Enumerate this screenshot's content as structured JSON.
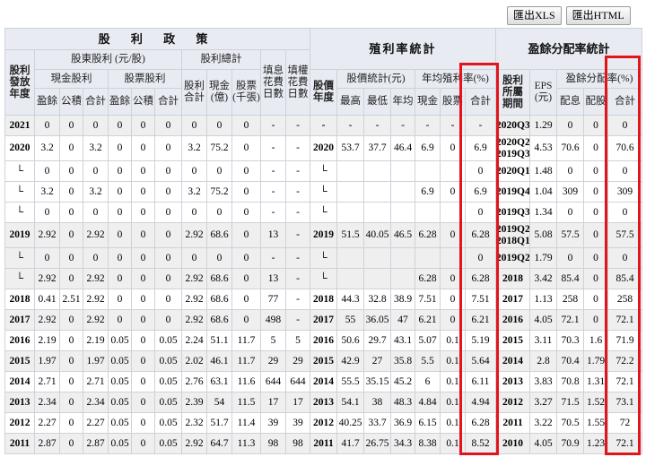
{
  "toolbar": {
    "export_xls": "匯出XLS",
    "export_html": "匯出HTML"
  },
  "colors": {
    "header_bg": "#e8ebf2",
    "row_shade": "#efefef",
    "highlight": "#e3151c"
  },
  "header": {
    "dividend_policy": "股 利 政 策",
    "yield_stats": "殖利率統計",
    "payout_stats": "盈餘分配率統計",
    "dividend_year": "股利\n發放\n年度",
    "shareholder_dividend": "股東股利 (元/股)",
    "dividend_total": "股利總計",
    "fill_dividend_days": "填息\n花費\n日數",
    "fill_rights_days": "填權\n花費\n日數",
    "cash_dividend": "現金股利",
    "stock_dividend": "股票股利",
    "dividend_sum": "股利\n合計",
    "cash_amount": "現金\n(億)",
    "stock_amount": "股票\n(千張)",
    "earnings": "盈餘",
    "reserve": "公積",
    "total": "合計",
    "price_year": "股價\n年度",
    "price_stats": "股價統計(元)",
    "avg_yield": "年均殖利率(%)",
    "high": "最高",
    "low": "最低",
    "avg": "年均",
    "cash": "現金",
    "stock": "股票",
    "period": "股利\n所屬\n期間",
    "eps": "EPS\n(元)",
    "payout_ratio": "盈餘分配率(%)",
    "cash_payout": "配息",
    "stock_payout": "配股"
  },
  "rows": [
    {
      "div": [
        "2021",
        "0",
        "0",
        "0",
        "0",
        "0",
        "0",
        "0",
        "0",
        "0",
        "-",
        "-"
      ],
      "yld": [
        "-",
        "-",
        "-",
        "-",
        "-",
        "-",
        "-"
      ],
      "pay": [
        "2020Q3",
        "1.29",
        "0",
        "0",
        "0"
      ]
    },
    {
      "div": [
        "2020",
        "3.2",
        "0",
        "3.2",
        "0",
        "0",
        "0",
        "3.2",
        "75.2",
        "0",
        "-",
        "-"
      ],
      "yld": [
        "2020",
        "53.7",
        "37.7",
        "46.4",
        "6.9",
        "0",
        "6.9"
      ],
      "pay": [
        "2020Q2\n2019Q3",
        "4.53",
        "70.6",
        "0",
        "70.6"
      ]
    },
    {
      "div": [
        "└",
        "0",
        "0",
        "0",
        "0",
        "0",
        "0",
        "0",
        "0",
        "0",
        "-",
        "-"
      ],
      "yld": [
        "└",
        "",
        "",
        "",
        "",
        "",
        "0"
      ],
      "pay": [
        "2020Q1",
        "1.48",
        "0",
        "0",
        "0"
      ]
    },
    {
      "div": [
        "└",
        "3.2",
        "0",
        "3.2",
        "0",
        "0",
        "0",
        "3.2",
        "75.2",
        "0",
        "-",
        "-"
      ],
      "yld": [
        "└",
        "",
        "",
        "",
        "6.9",
        "0",
        "6.9"
      ],
      "pay": [
        "2019Q4",
        "1.04",
        "309",
        "0",
        "309"
      ]
    },
    {
      "div": [
        "└",
        "0",
        "0",
        "0",
        "0",
        "0",
        "0",
        "0",
        "0",
        "0",
        "-",
        "-"
      ],
      "yld": [
        "└",
        "",
        "",
        "",
        "",
        "",
        "0"
      ],
      "pay": [
        "2019Q3",
        "1.34",
        "0",
        "0",
        "0"
      ]
    },
    {
      "div": [
        "2019",
        "2.92",
        "0",
        "2.92",
        "0",
        "0",
        "0",
        "2.92",
        "68.6",
        "0",
        "13",
        "-"
      ],
      "yld": [
        "2019",
        "51.5",
        "40.05",
        "46.5",
        "6.28",
        "0",
        "6.28"
      ],
      "pay": [
        "2019Q2\n2018Q1",
        "5.08",
        "57.5",
        "0",
        "57.5"
      ]
    },
    {
      "div": [
        "└",
        "0",
        "0",
        "0",
        "0",
        "0",
        "0",
        "0",
        "0",
        "0",
        "-",
        "-"
      ],
      "yld": [
        "└",
        "",
        "",
        "",
        "",
        "",
        "0"
      ],
      "pay": [
        "2019Q2",
        "1.79",
        "0",
        "0",
        "0"
      ]
    },
    {
      "div": [
        "└",
        "2.92",
        "0",
        "2.92",
        "0",
        "0",
        "0",
        "2.92",
        "68.6",
        "0",
        "13",
        "-"
      ],
      "yld": [
        "└",
        "",
        "",
        "",
        "6.28",
        "0",
        "6.28"
      ],
      "pay": [
        "2018",
        "3.42",
        "85.4",
        "0",
        "85.4"
      ]
    },
    {
      "div": [
        "2018",
        "0.41",
        "2.51",
        "2.92",
        "0",
        "0",
        "0",
        "2.92",
        "68.6",
        "0",
        "77",
        "-"
      ],
      "yld": [
        "2018",
        "44.3",
        "32.8",
        "38.9",
        "7.51",
        "0",
        "7.51"
      ],
      "pay": [
        "2017",
        "1.13",
        "258",
        "0",
        "258"
      ]
    },
    {
      "div": [
        "2017",
        "2.92",
        "0",
        "2.92",
        "0",
        "0",
        "0",
        "2.92",
        "68.6",
        "0",
        "498",
        "-"
      ],
      "yld": [
        "2017",
        "55",
        "36.05",
        "47",
        "6.21",
        "0",
        "6.21"
      ],
      "pay": [
        "2016",
        "4.05",
        "72.1",
        "0",
        "72.1"
      ]
    },
    {
      "div": [
        "2016",
        "2.19",
        "0",
        "2.19",
        "0.05",
        "0",
        "0.05",
        "2.24",
        "51.1",
        "11.7",
        "5",
        "5"
      ],
      "yld": [
        "2016",
        "50.6",
        "29.7",
        "43.1",
        "5.07",
        "0.1",
        "5.19"
      ],
      "pay": [
        "2015",
        "3.11",
        "70.3",
        "1.6",
        "71.9"
      ]
    },
    {
      "div": [
        "2015",
        "1.97",
        "0",
        "1.97",
        "0.05",
        "0",
        "0.05",
        "2.02",
        "46.1",
        "11.7",
        "29",
        "29"
      ],
      "yld": [
        "2015",
        "42.9",
        "27",
        "35.8",
        "5.5",
        "0.1",
        "5.64"
      ],
      "pay": [
        "2014",
        "2.8",
        "70.4",
        "1.79",
        "72.2"
      ]
    },
    {
      "div": [
        "2014",
        "2.71",
        "0",
        "2.71",
        "0.05",
        "0",
        "0.05",
        "2.76",
        "63.1",
        "11.6",
        "644",
        "644"
      ],
      "yld": [
        "2014",
        "55.5",
        "35.15",
        "45.2",
        "6",
        "0.1",
        "6.11"
      ],
      "pay": [
        "2013",
        "3.83",
        "70.8",
        "1.31",
        "72.1"
      ]
    },
    {
      "div": [
        "2013",
        "2.34",
        "0",
        "2.34",
        "0.05",
        "0",
        "0.05",
        "2.39",
        "54",
        "11.5",
        "17",
        "17"
      ],
      "yld": [
        "2013",
        "54.1",
        "38",
        "48.3",
        "4.84",
        "0.1",
        "4.94"
      ],
      "pay": [
        "2012",
        "3.27",
        "71.5",
        "1.52",
        "73.1"
      ]
    },
    {
      "div": [
        "2012",
        "2.27",
        "0",
        "2.27",
        "0.05",
        "0",
        "0.05",
        "2.32",
        "51.7",
        "11.4",
        "39",
        "39"
      ],
      "yld": [
        "2012",
        "40.25",
        "33.7",
        "36.9",
        "6.15",
        "0.1",
        "6.28"
      ],
      "pay": [
        "2011",
        "3.22",
        "70.5",
        "1.55",
        "72"
      ]
    },
    {
      "div": [
        "2011",
        "2.87",
        "0",
        "2.87",
        "0.05",
        "0",
        "0.05",
        "2.92",
        "64.7",
        "11.3",
        "98",
        "98"
      ],
      "yld": [
        "2011",
        "41.7",
        "26.75",
        "34.3",
        "8.38",
        "0.1",
        "8.52"
      ],
      "pay": [
        "2010",
        "4.05",
        "70.9",
        "1.23",
        "72.1"
      ]
    }
  ]
}
